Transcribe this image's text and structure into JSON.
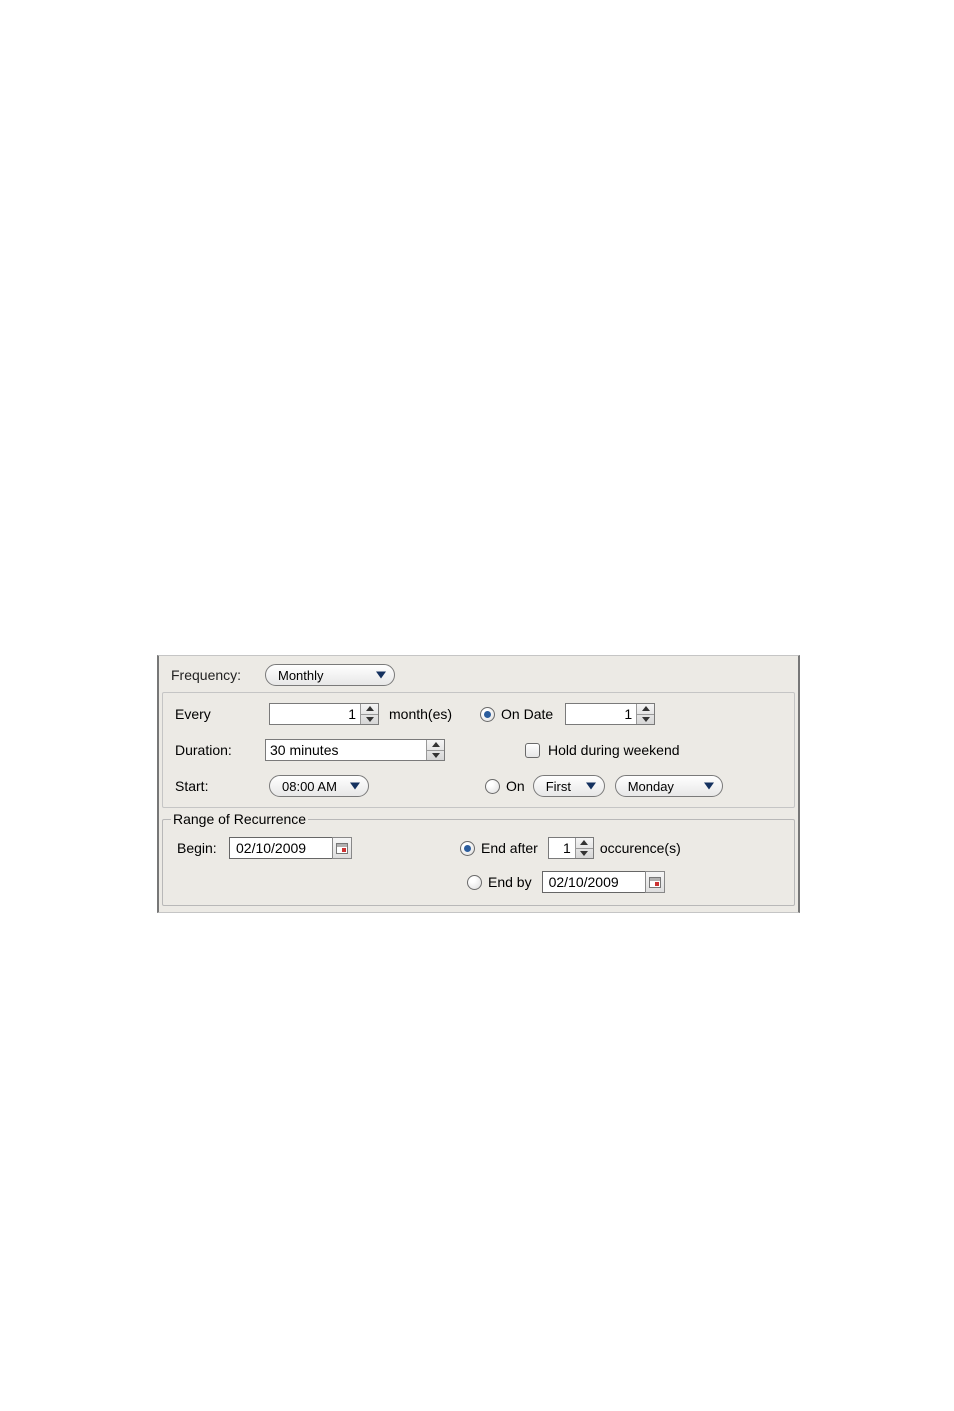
{
  "frequency": {
    "label": "Frequency:",
    "value": "Monthly"
  },
  "every": {
    "label": "Every",
    "value": "1",
    "unit": "month(es)"
  },
  "on_date": {
    "radio_label": "On Date",
    "value": "1",
    "selected": true
  },
  "duration": {
    "label": "Duration:",
    "value": "30 minutes"
  },
  "hold_weekend": {
    "label": "Hold during weekend",
    "checked": false
  },
  "start": {
    "label": "Start:",
    "value": "08:00 AM"
  },
  "on_weekday": {
    "radio_label": "On",
    "ordinal": "First",
    "weekday": "Monday",
    "selected": false
  },
  "range": {
    "legend": "Range of Recurrence",
    "begin": {
      "label": "Begin:",
      "value": "02/10/2009"
    },
    "end_after": {
      "label": "End after",
      "value": "1",
      "unit": "occurence(s)",
      "selected": true
    },
    "end_by": {
      "label": "End by",
      "value": "02/10/2009",
      "selected": false
    }
  }
}
